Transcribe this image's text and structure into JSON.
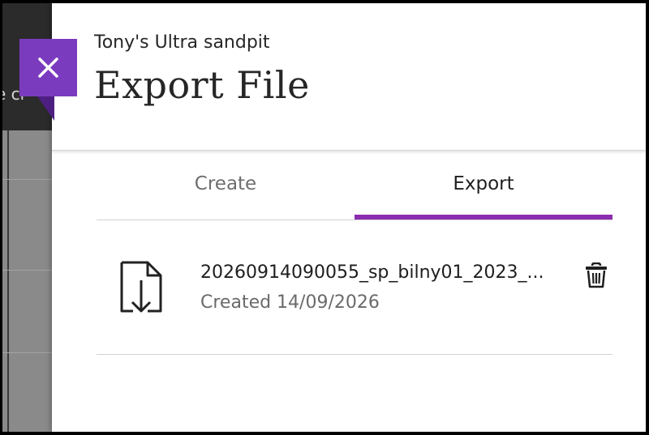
{
  "background": {
    "header_text": "e cr"
  },
  "panel": {
    "subtitle": "Tony's Ultra sandpit",
    "title": "Export File",
    "close_icon": "close-x-icon"
  },
  "tabs": [
    {
      "label": "Create",
      "active": false
    },
    {
      "label": "Export",
      "active": true
    }
  ],
  "export_files": [
    {
      "name": "20260914090055_sp_bilny01_2023_...",
      "created": "Created 14/09/2026",
      "icon": "file-download-icon",
      "action_icon": "trash-icon"
    }
  ],
  "colors": {
    "accent": "#7b3bbf",
    "tab_underline": "#8b2dae"
  }
}
